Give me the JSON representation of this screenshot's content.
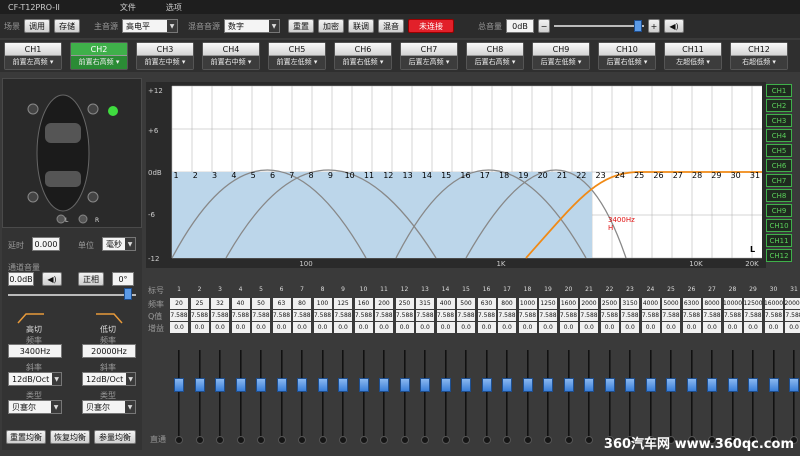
{
  "title": "CF-T12PRO-II",
  "menu": [
    "文件",
    "选项"
  ],
  "topbar": {
    "scene_label": "场景",
    "recall": "调用",
    "save": "存储",
    "source_label": "主音源",
    "source_value": "高电平",
    "mix_label": "混音音源",
    "mix_value": "数字",
    "reset": "重置",
    "encrypt": "加密",
    "link": "联调",
    "mix": "混音",
    "status": "未连接",
    "master_label": "总音量",
    "master_value": "0dB"
  },
  "channels": [
    {
      "name": "CH1",
      "pos": "前置左高频"
    },
    {
      "name": "CH2",
      "pos": "前置右高频",
      "active": true
    },
    {
      "name": "CH3",
      "pos": "前置左中频"
    },
    {
      "name": "CH4",
      "pos": "前置右中频"
    },
    {
      "name": "CH5",
      "pos": "前置左低频"
    },
    {
      "name": "CH6",
      "pos": "前置右低频"
    },
    {
      "name": "CH7",
      "pos": "后置左高频"
    },
    {
      "name": "CH8",
      "pos": "后置右高频"
    },
    {
      "name": "CH9",
      "pos": "后置左低频"
    },
    {
      "name": "CH10",
      "pos": "后置右低频"
    },
    {
      "name": "CH11",
      "pos": "左超低频"
    },
    {
      "name": "CH12",
      "pos": "右超低频"
    }
  ],
  "left": {
    "delay_label": "延时",
    "delay_value": "0.000",
    "unit_label": "单位",
    "unit_value": "毫秒",
    "chvol_label": "通道音量",
    "chvol_value": "0.0dB",
    "phase": "正相",
    "phase_deg": "0°",
    "hp_label": "高切",
    "lp_label": "低切",
    "freq_label": "频率",
    "hp_freq": "3400Hz",
    "lp_freq": "20000Hz",
    "slope_label": "斜率",
    "hp_slope": "12dB/Oct",
    "lp_slope": "12dB/Oct",
    "type_label": "类型",
    "hp_type": "贝塞尔",
    "lp_type": "贝塞尔",
    "btn_reset_eq": "重置均衡",
    "btn_restore_eq": "恢复均衡",
    "btn_param_eq": "参量均衡",
    "car_L": "L",
    "car_R": "R"
  },
  "graph": {
    "y_labels": [
      "+12",
      "+6",
      "0dB",
      "-6",
      "-12"
    ],
    "x_labels": [
      "100",
      "1K",
      "10K",
      "20K"
    ],
    "bands": [
      "1",
      "2",
      "3",
      "4",
      "5",
      "6",
      "7",
      "8",
      "9",
      "10",
      "11",
      "12",
      "13",
      "14",
      "15",
      "16",
      "17",
      "18",
      "19",
      "20",
      "21",
      "22",
      "23",
      "24",
      "25",
      "26",
      "27",
      "28",
      "29",
      "30",
      "31"
    ],
    "cut_label": "3400Hz",
    "cut_sub": "H",
    "side_label": "L"
  },
  "right_list": [
    "CH1",
    "CH2",
    "CH3",
    "CH4",
    "CH5",
    "CH6",
    "CH7",
    "CH8",
    "CH9",
    "CH10",
    "CH11",
    "CH12"
  ],
  "eq": {
    "row_labels": [
      "标号",
      "频率",
      "Q值",
      "增益"
    ],
    "freqs": [
      "20",
      "25",
      "32",
      "40",
      "50",
      "63",
      "80",
      "100",
      "125",
      "160",
      "200",
      "250",
      "315",
      "400",
      "500",
      "630",
      "800",
      "1000",
      "1250",
      "1600",
      "2000",
      "2500",
      "3150",
      "4000",
      "5000",
      "6300",
      "8000",
      "10000",
      "12500",
      "16000",
      "20000"
    ],
    "q": "7.588",
    "gain": "0.0",
    "bypass_label": "直通"
  },
  "watermark": "360汽车网 www.360qc.com"
}
